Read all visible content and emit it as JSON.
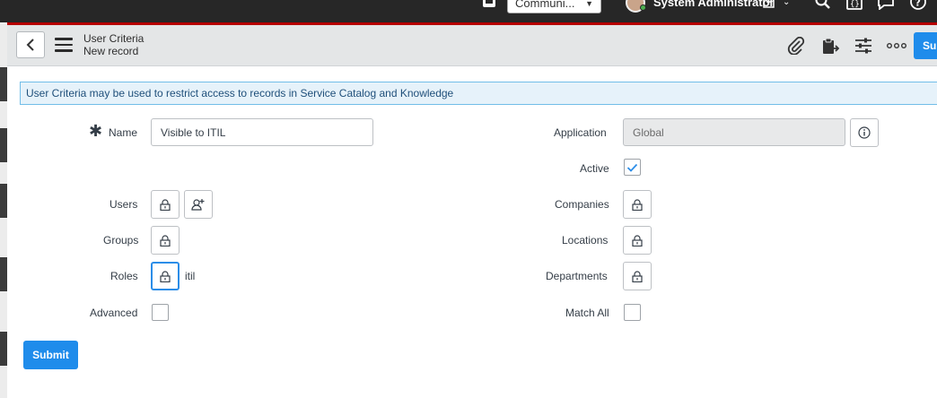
{
  "topbar": {
    "scope": {
      "value": "Communi..."
    },
    "user_name": "System Administrator",
    "icons": [
      "chat-bubble-icon",
      "dropdown-caret-icon",
      "search-icon",
      "script-icon",
      "comment-icon",
      "help-icon"
    ]
  },
  "header": {
    "title": "User Criteria",
    "subtitle": "New record",
    "submit_label": "Submit",
    "icons": [
      "paperclip-icon",
      "clipboard-icon",
      "sliders-icon",
      "more-icon"
    ]
  },
  "banner": {
    "text": "User Criteria may be used to restrict access to records in Service Catalog and Knowledge"
  },
  "form": {
    "name": {
      "label": "Name",
      "value": "Visible to ITIL",
      "required": true
    },
    "application": {
      "label": "Application",
      "value": "Global"
    },
    "active": {
      "label": "Active",
      "checked": true
    },
    "users": {
      "label": "Users"
    },
    "companies": {
      "label": "Companies"
    },
    "groups": {
      "label": "Groups"
    },
    "locations": {
      "label": "Locations"
    },
    "roles": {
      "label": "Roles",
      "value": "itil"
    },
    "departments": {
      "label": "Departments"
    },
    "advanced": {
      "label": "Advanced",
      "checked": false
    },
    "match_all": {
      "label": "Match All",
      "checked": false
    }
  },
  "footer": {
    "submit_label": "Submit"
  },
  "colors": {
    "accent": "#1f8ceb",
    "banner_bg": "#e6f2fa",
    "banner_border": "#71bde8",
    "header_bg": "#e4e6e7",
    "topbar_bg": "#272727",
    "topbar_accent": "#b60000"
  }
}
